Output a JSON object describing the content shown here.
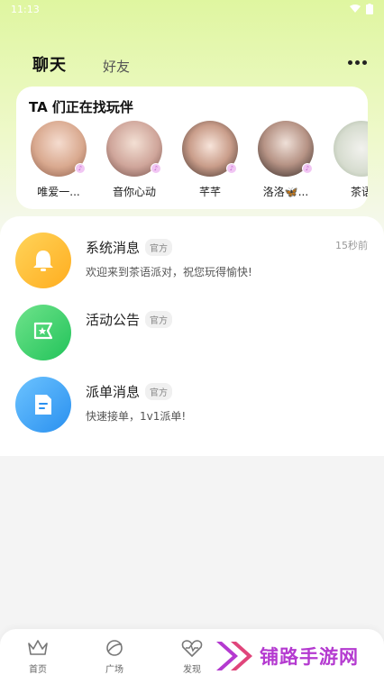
{
  "status_bar": {
    "time": "11:13"
  },
  "header": {
    "tabs": [
      {
        "label": "聊天",
        "active": true
      },
      {
        "label": "好友",
        "active": false
      }
    ]
  },
  "ta_card": {
    "title": "TA 们正在找玩伴",
    "users": [
      {
        "name": "唯爱一..."
      },
      {
        "name": "音你心动"
      },
      {
        "name": "芊芊"
      },
      {
        "name": "洛洛🦋..."
      },
      {
        "name": "茶语"
      }
    ]
  },
  "messages": [
    {
      "title": "系统消息",
      "tag": "官方",
      "subtitle": "欢迎来到茶语派对，祝您玩得愉快!",
      "time": "15秒前"
    },
    {
      "title": "活动公告",
      "tag": "官方",
      "subtitle": "",
      "time": ""
    },
    {
      "title": "派单消息",
      "tag": "官方",
      "subtitle": "快速接单，1v1派单!",
      "time": ""
    }
  ],
  "bottom_nav": [
    {
      "label": "首页",
      "icon": "crown-icon"
    },
    {
      "label": "广场",
      "icon": "planet-icon"
    },
    {
      "label": "发现",
      "icon": "heartbeat-icon"
    }
  ],
  "watermark": {
    "text": "铺路手游网"
  },
  "colors": {
    "header_gradient_top": "#dff6a0",
    "system_icon": "#ffc233",
    "activity_icon": "#3ed36b",
    "dispatch_icon": "#3aa6f5",
    "watermark": "#b43ad0"
  }
}
